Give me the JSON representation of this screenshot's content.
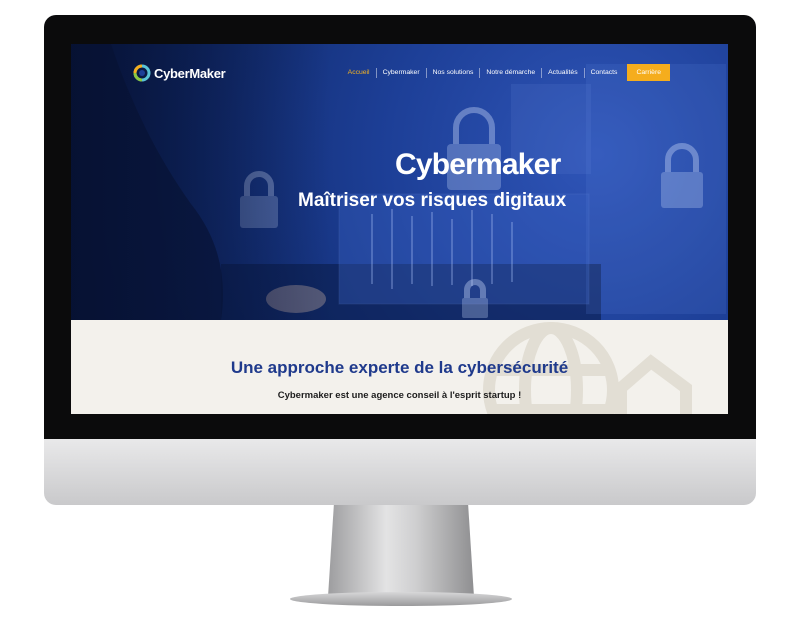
{
  "site": {
    "logo_text": "CyberMaker",
    "nav": [
      "Accueil",
      "Cybermaker",
      "Nos solutions",
      "Notre démarche",
      "Actualités",
      "Contacts"
    ],
    "cta": "Carrière"
  },
  "hero": {
    "title": "Cybermaker",
    "subtitle": "Maîtriser vos risques digitaux"
  },
  "intro": {
    "title": "Une approche experte de la cybersécurité",
    "text": "Cybermaker est une agence conseil à l'esprit startup !"
  },
  "colors": {
    "hero_blue": "#1d3f97",
    "accent_yellow": "#f5ad1d",
    "title_blue": "#1f3a8c",
    "section_bg": "#f3f1ec"
  }
}
